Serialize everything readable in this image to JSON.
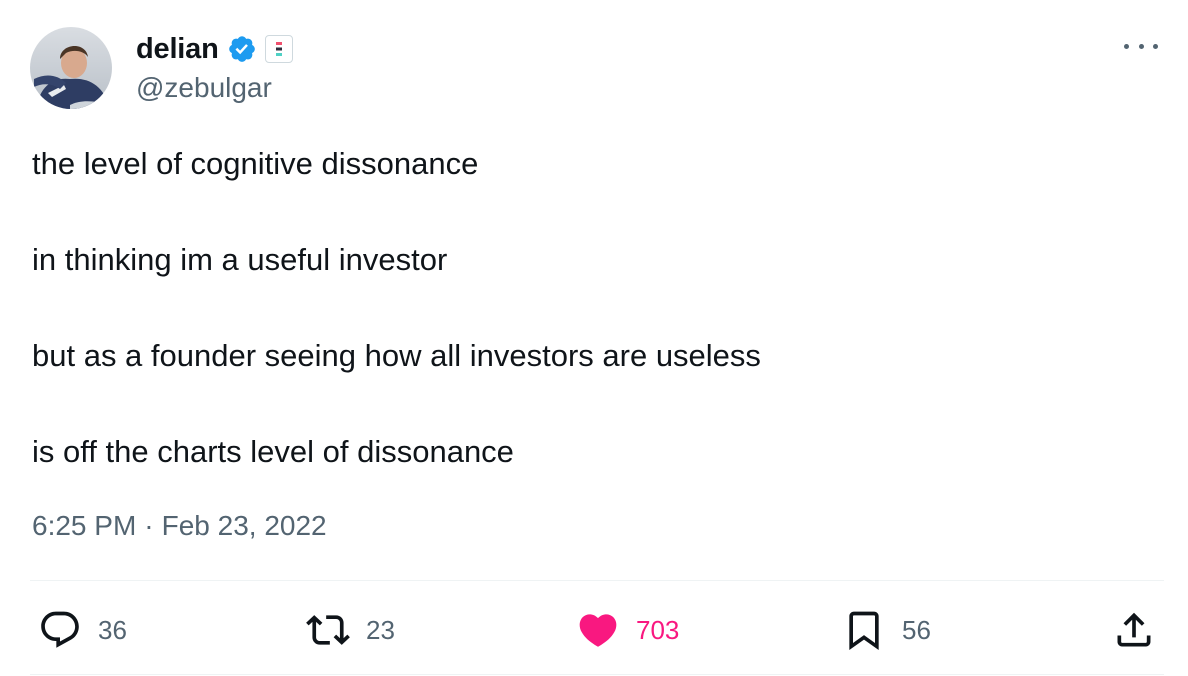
{
  "user": {
    "display_name": "delian",
    "handle": "@zebulgar",
    "verified": true,
    "avatar_icon": "profile-photo"
  },
  "tweet": {
    "paragraphs": [
      "the level of cognitive dissonance",
      "in thinking im a useful investor",
      "but as a founder seeing how all investors are useless",
      "is off the charts level of dissonance"
    ],
    "time": "6:25 PM",
    "separator": "·",
    "date": "Feb 23, 2022"
  },
  "actions": {
    "replies": {
      "icon": "reply-icon",
      "count": "36"
    },
    "retweets": {
      "icon": "retweet-icon",
      "count": "23"
    },
    "likes": {
      "icon": "heart-icon",
      "count": "703",
      "active": true
    },
    "bookmarks": {
      "icon": "bookmark-icon",
      "count": "56"
    },
    "share": {
      "icon": "share-icon"
    }
  },
  "colors": {
    "text": "#0f1419",
    "secondary": "#536471",
    "verified": "#1d9bf0",
    "like": "#f91880",
    "divider": "#eff3f4"
  }
}
